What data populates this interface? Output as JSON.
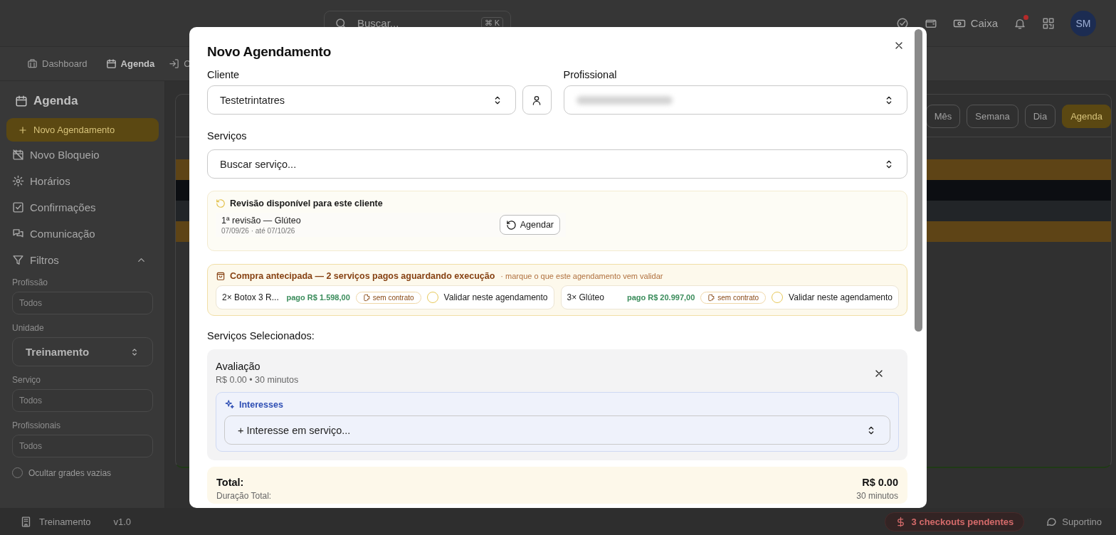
{
  "topbar": {
    "search": {
      "placeholder": "Buscar...",
      "shortcut": "⌘ K"
    },
    "cash_button": "Caixa",
    "notifications": {
      "unread": true
    },
    "avatar": "SM"
  },
  "nav_tabs": [
    {
      "label": "Dashboard",
      "selected": false
    },
    {
      "label": "Agenda",
      "selected": true
    },
    {
      "label": "C",
      "selected": false
    }
  ],
  "sidebar": {
    "title": "Agenda",
    "new_button": "Novo Agendamento",
    "items": [
      {
        "label": "Novo Bloqueio"
      },
      {
        "label": "Horários"
      },
      {
        "label": "Confirmações"
      },
      {
        "label": "Comunicação"
      }
    ],
    "filters": {
      "title": "Filtros",
      "expanded": true,
      "fields": [
        {
          "label": "Profissão",
          "kind": "input",
          "placeholder": "Todos"
        },
        {
          "label": "Unidade",
          "kind": "select",
          "value": "Treinamento"
        },
        {
          "label": "Serviço",
          "kind": "input",
          "placeholder": "Todos"
        },
        {
          "label": "Profissionais",
          "kind": "input",
          "placeholder": "Todos"
        }
      ],
      "hide_empty": {
        "label": "Ocultar grades vazias",
        "checked": false
      }
    }
  },
  "calendar": {
    "views": [
      {
        "label": "Mês",
        "selected": false
      },
      {
        "label": "Semana",
        "selected": false
      },
      {
        "label": "Dia",
        "selected": false
      },
      {
        "label": "Agenda",
        "selected": true
      }
    ],
    "events": [
      {
        "color": "#5e4416"
      },
      {
        "color": "#0c0e12"
      },
      {
        "color": "#222528"
      },
      {
        "color": "#5e4416"
      }
    ]
  },
  "modal": {
    "title": "Novo Agendamento",
    "client": {
      "label": "Cliente",
      "value": "Testetrintatres"
    },
    "professional": {
      "label": "Profissional"
    },
    "services": {
      "label": "Serviços",
      "placeholder": "Buscar serviço..."
    },
    "revision": {
      "title": "Revisão disponível para este cliente",
      "items": [
        {
          "name": "1ª revisão — Glúteo",
          "dates": "07/09/26 · até 07/10/26",
          "button": "Agendar"
        }
      ]
    },
    "prepaid": {
      "title": "Compra antecipada — 2 serviços pagos aguardando execução",
      "hint": "· marque o que este agendamento vem validar",
      "items": [
        {
          "name": "2× Botox 3 R...",
          "paid": "pago R$ 1.598,00",
          "contract": "sem contrato",
          "validate_label": "Validar neste agendamento",
          "checked": false
        },
        {
          "name": "3× Glúteo",
          "paid": "pago R$ 20.997,00",
          "contract": "sem contrato",
          "validate_label": "Validar neste agendamento",
          "checked": false
        }
      ]
    },
    "selected_title": "Serviços Selecionados:",
    "selected_services": [
      {
        "name": "Avaliação",
        "details": "R$ 0.00 • 30 minutos",
        "interests": {
          "title": "Interesses",
          "placeholder": "+ Interesse em serviço..."
        }
      }
    ],
    "total": {
      "label": "Total:",
      "value": "R$ 0.00",
      "duration_label": "Duração Total:",
      "duration_value": "30 minutos"
    }
  },
  "status_bar": {
    "unit": "Treinamento",
    "version": "v1.0",
    "checkouts": "3 checkouts pendentes",
    "support": "Suportino"
  }
}
